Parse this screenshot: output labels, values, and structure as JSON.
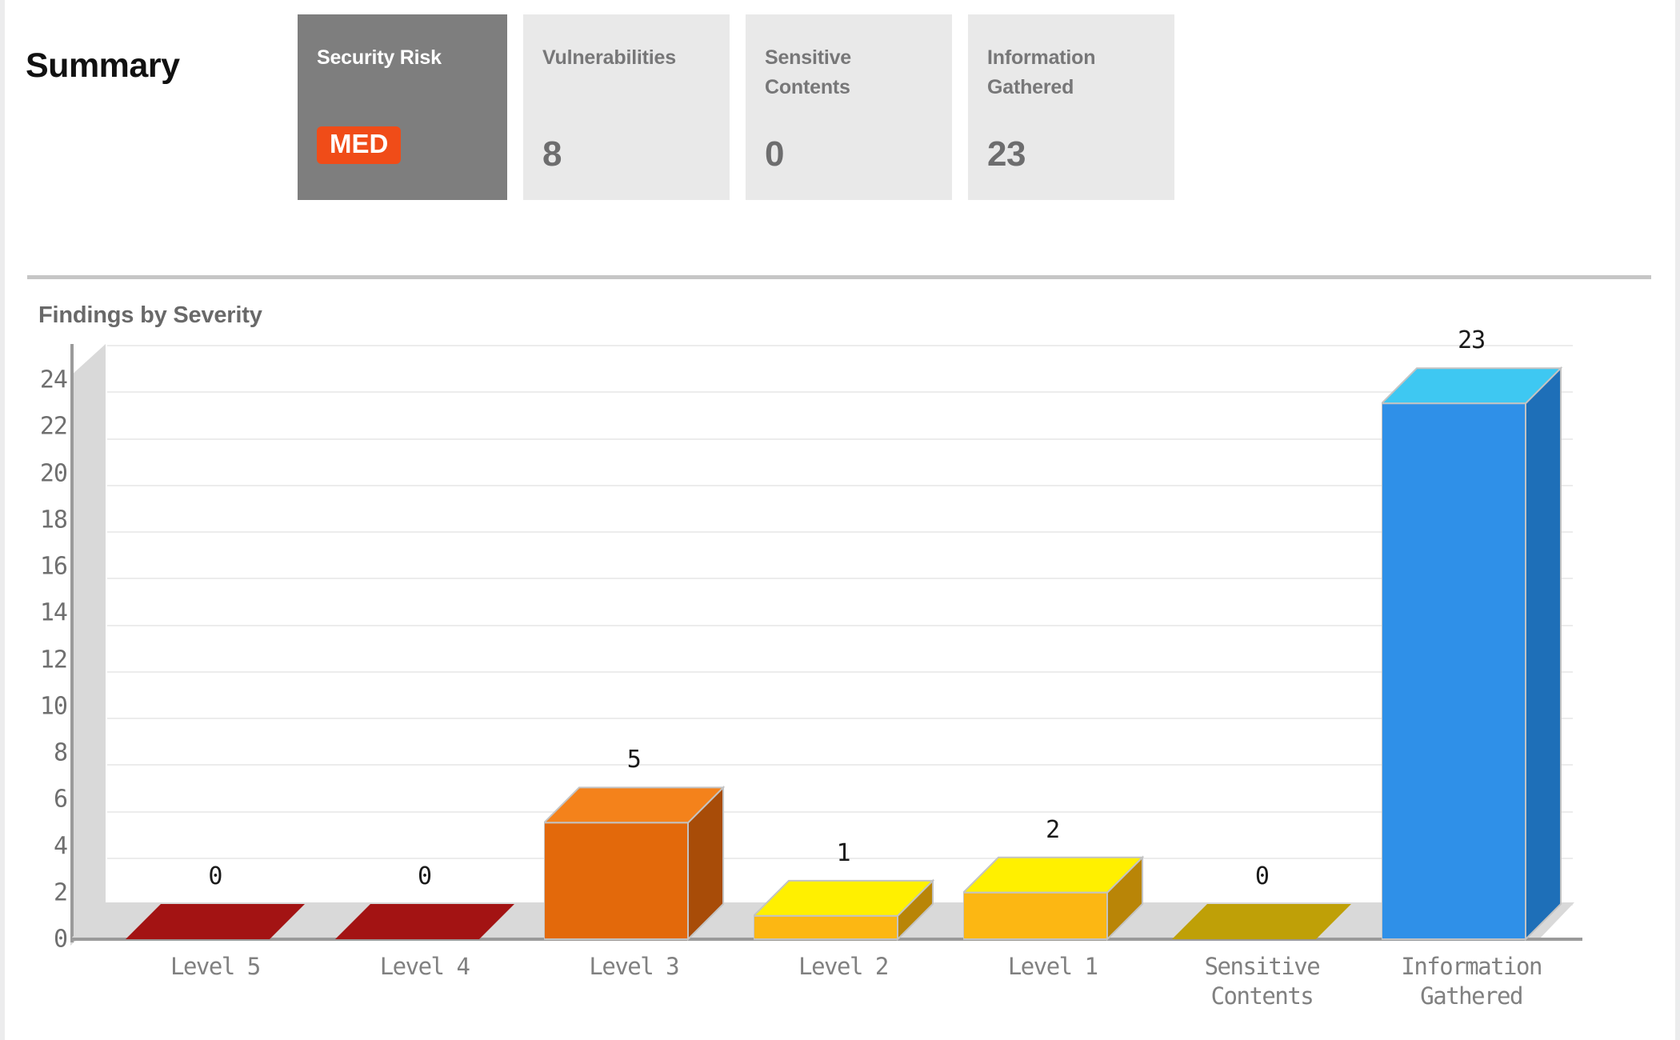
{
  "summary": {
    "title": "Summary",
    "cards": [
      {
        "label": "Security Risk",
        "badge": "MED",
        "value": null,
        "variant": "primary",
        "name": "security-risk"
      },
      {
        "label": "Vulnerabilities",
        "badge": null,
        "value": "8",
        "variant": "default",
        "name": "vulnerabilities"
      },
      {
        "label": "Sensitive\nContents",
        "badge": null,
        "value": "0",
        "variant": "default",
        "name": "sensitive-contents"
      },
      {
        "label": "Information\nGathered",
        "badge": null,
        "value": "23",
        "variant": "default",
        "name": "information-gathered"
      }
    ]
  },
  "chart_section": {
    "title": "Findings by Severity"
  },
  "colors": {
    "risk_badge": "#f04c18",
    "card_bg": "#e9e9e9",
    "card_primary_bg": "#7e7e7e",
    "card_text": "#777778",
    "divider": "#c6c6c6",
    "gridline": "#ececec",
    "axis": "#9a9a9a",
    "floor": "#d9d9d9"
  },
  "chart_data": {
    "type": "bar",
    "title": "Findings by Severity",
    "xlabel": "",
    "ylabel": "",
    "ylim": [
      0,
      25
    ],
    "yticks": [
      0,
      2,
      4,
      6,
      8,
      10,
      12,
      14,
      16,
      18,
      20,
      22,
      24
    ],
    "grid": true,
    "legend": "none",
    "style": "3d-bars",
    "categories": [
      "Level 5",
      "Level 4",
      "Level 3",
      "Level 2",
      "Level 1",
      "Sensitive Contents",
      "Information Gathered"
    ],
    "values": [
      0,
      0,
      5,
      1,
      2,
      0,
      23
    ],
    "bar_colors": [
      {
        "front": "#8c0e0e",
        "top": "#a31313",
        "side": "#6d0b0b"
      },
      {
        "front": "#8c0e0e",
        "top": "#a31313",
        "side": "#6d0b0b"
      },
      {
        "front": "#e3690b",
        "top": "#f4821b",
        "side": "#a84c08"
      },
      {
        "front": "#fcb713",
        "top": "#fff000",
        "side": "#b98507"
      },
      {
        "front": "#fcb713",
        "top": "#fff000",
        "side": "#b98507"
      },
      {
        "front": "#bfa007",
        "top": "#bfa007",
        "side": "#8f7705"
      },
      {
        "front": "#2f90e8",
        "top": "#3ec8f2",
        "side": "#1e6fb8"
      }
    ],
    "data_labels": [
      "0",
      "0",
      "5",
      "1",
      "2",
      "0",
      "23"
    ]
  }
}
